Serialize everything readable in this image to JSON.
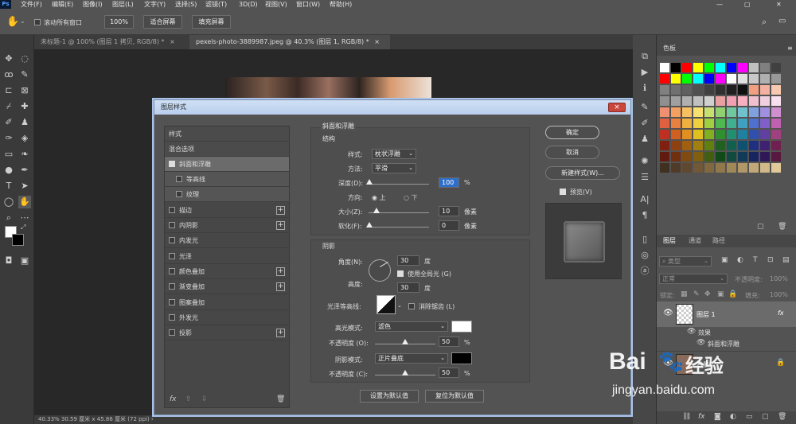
{
  "menubar": {
    "items": [
      "文件(F)",
      "编辑(E)",
      "图像(I)",
      "图层(L)",
      "文字(Y)",
      "选择(S)",
      "滤镜(T)",
      "3D(D)",
      "视图(V)",
      "窗口(W)",
      "帮助(H)"
    ]
  },
  "options": {
    "scroll_all_label": "滚动所有窗口",
    "zoom_value": "100%",
    "fit_screen": "适合屏幕",
    "fill_screen": "填充屏幕"
  },
  "doc_tabs": [
    {
      "label": "未标题-1 @ 100% (图层 1 拷贝, RGB/8) *",
      "close": "×"
    },
    {
      "label": "pexels-photo-3889987.jpeg @ 40.3% (图层 1, RGB/8) *",
      "close": "×"
    }
  ],
  "statusbar": {
    "text": "40.33%    30.59 厘米 x 45.86 厘米 (72 ppi)    ›"
  },
  "dialog": {
    "title": "图层样式",
    "close": "×",
    "styles_header": "样式",
    "blend_options": "混合选项",
    "items": [
      {
        "label": "斜面和浮雕",
        "checked": true,
        "plus": false,
        "sub": false
      },
      {
        "label": "等高线",
        "checked": false,
        "plus": false,
        "sub": true
      },
      {
        "label": "纹理",
        "checked": false,
        "plus": false,
        "sub": true
      },
      {
        "label": "描边",
        "checked": false,
        "plus": true,
        "sub": false
      },
      {
        "label": "内阴影",
        "checked": false,
        "plus": true,
        "sub": false
      },
      {
        "label": "内发光",
        "checked": false,
        "plus": false,
        "sub": false
      },
      {
        "label": "光泽",
        "checked": false,
        "plus": false,
        "sub": false
      },
      {
        "label": "颜色叠加",
        "checked": false,
        "plus": true,
        "sub": false
      },
      {
        "label": "渐变叠加",
        "checked": false,
        "plus": true,
        "sub": false
      },
      {
        "label": "图案叠加",
        "checked": false,
        "plus": false,
        "sub": false
      },
      {
        "label": "外发光",
        "checked": false,
        "plus": false,
        "sub": false
      },
      {
        "label": "投影",
        "checked": false,
        "plus": true,
        "sub": false
      }
    ],
    "footer_icons": {
      "fx": "fx",
      "up": "⇧",
      "down": "⇩",
      "trash": "🗑"
    },
    "bevel": {
      "section_title": "斜面和浮雕",
      "structure_title": "结构",
      "style_label": "样式:",
      "style_value": "枕状浮雕",
      "technique_label": "方法:",
      "technique_value": "平滑",
      "depth_label": "深度(D):",
      "depth_value": "100",
      "depth_unit": "%",
      "direction_label": "方向:",
      "dir_up": "上",
      "dir_down": "下",
      "size_label": "大小(Z):",
      "size_value": "10",
      "size_unit": "像素",
      "soften_label": "软化(F):",
      "soften_value": "0",
      "soften_unit": "像素"
    },
    "shading": {
      "title": "阴影",
      "angle_label": "角度(N):",
      "angle_value": "30",
      "angle_unit": "度",
      "global_light": "使用全局光 (G)",
      "altitude_label": "高度:",
      "altitude_value": "30",
      "altitude_unit": "度",
      "gloss_label": "光泽等高线:",
      "antialias": "消除锯齿 (L)",
      "highlight_mode_label": "高光模式:",
      "highlight_mode_value": "滤色",
      "highlight_color": "#ffffff",
      "hl_opacity_label": "不透明度 (O):",
      "hl_opacity_value": "50",
      "hl_opacity_unit": "%",
      "shadow_mode_label": "阴影模式:",
      "shadow_mode_value": "正片叠底",
      "shadow_color": "#000000",
      "sh_opacity_label": "不透明度 (C):",
      "sh_opacity_value": "50",
      "sh_opacity_unit": "%",
      "make_default": "设置为默认值",
      "reset_default": "复位为默认值"
    },
    "buttons": {
      "ok": "确定",
      "cancel": "取消",
      "new_style": "新建样式(W)...",
      "preview": "预览(V)"
    }
  },
  "swatches_panel": {
    "title": "色板"
  },
  "layers_panel": {
    "tabs": [
      "图层",
      "通道",
      "路径"
    ],
    "kind_label": "类型",
    "blend_mode": "正常",
    "opacity_label": "不透明度:",
    "opacity_value": "100%",
    "lock_label": "锁定:",
    "fill_label": "填充:",
    "fill_value": "100%",
    "layer1": "图层 1",
    "fx": "fx",
    "effects": "效果",
    "bevel_effect": "斜面和浮雕",
    "background": "背景"
  },
  "watermark": {
    "brand": "Bai",
    "brand_tail": "经验",
    "url": "jingyan.baidu.com"
  }
}
